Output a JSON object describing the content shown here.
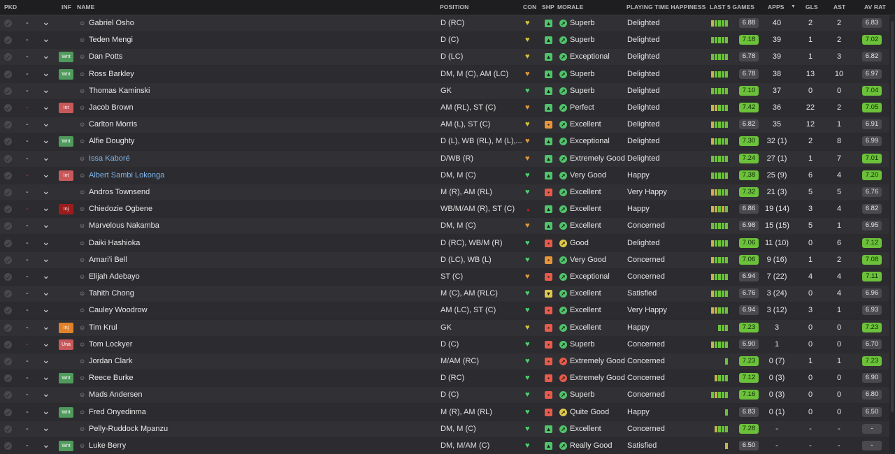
{
  "headers": {
    "pkd": "PKD",
    "inf": "INF",
    "name": "NAME",
    "position": "POSITION",
    "con": "CON",
    "shp": "SHP",
    "morale": "MORALE",
    "pth": "PLAYING TIME HAPPINESS",
    "last5": "LAST 5 GAMES",
    "apps": "APPS",
    "sort_indicator": "▼",
    "gls": "GLS",
    "ast": "AST",
    "avrat": "AV RAT"
  },
  "colors": {
    "rating_green": "#6cc13a",
    "rating_grey": "#4a4a4e",
    "link_blue": "#7fb4e8",
    "warn_red": "#c0392b"
  },
  "players": [
    {
      "pkd": "-",
      "pkd_red": false,
      "inf": "",
      "name": "Gabriel Osho",
      "link": false,
      "position": "D (RC)",
      "con": "yellow",
      "shp": "green",
      "mor_icon": "green",
      "morale": "Superb",
      "pth": "Delighted",
      "last5": [
        "y",
        "g",
        "g",
        "g",
        "g"
      ],
      "l5val": "6.88",
      "l5green": false,
      "apps": "40",
      "gls": "2",
      "ast": "2",
      "avrat": "6.83",
      "avgreen": false
    },
    {
      "pkd": "-",
      "pkd_red": false,
      "inf": "",
      "name": "Teden Mengi",
      "link": false,
      "position": "D (C)",
      "con": "yellow",
      "shp": "green",
      "mor_icon": "green",
      "morale": "Superb",
      "pth": "Delighted",
      "last5": [
        "g",
        "g",
        "g",
        "g",
        "g"
      ],
      "l5val": "7.18",
      "l5green": true,
      "apps": "39",
      "gls": "1",
      "ast": "2",
      "avrat": "7.02",
      "avgreen": true
    },
    {
      "pkd": "-",
      "pkd_red": false,
      "inf": "Wnt",
      "name": "Dan Potts",
      "link": false,
      "position": "D (LC)",
      "con": "yellow",
      "shp": "green",
      "mor_icon": "green",
      "morale": "Exceptional",
      "pth": "Delighted",
      "last5": [
        "g",
        "g",
        "g",
        "g",
        "g"
      ],
      "l5val": "6.78",
      "l5green": false,
      "apps": "39",
      "gls": "1",
      "ast": "3",
      "avrat": "6.82",
      "avgreen": false
    },
    {
      "pkd": "-",
      "pkd_red": false,
      "inf": "Wnt",
      "name": "Ross Barkley",
      "link": false,
      "position": "DM, M (C), AM (LC)",
      "con": "orange",
      "shp": "green",
      "mor_icon": "green",
      "morale": "Superb",
      "pth": "Delighted",
      "last5": [
        "y",
        "g",
        "g",
        "g",
        "g"
      ],
      "l5val": "6.78",
      "l5green": false,
      "apps": "38",
      "gls": "13",
      "ast": "10",
      "avrat": "6.97",
      "avgreen": false
    },
    {
      "pkd": "-",
      "pkd_red": false,
      "inf": "",
      "name": "Thomas Kaminski",
      "link": false,
      "position": "GK",
      "con": "green",
      "shp": "green",
      "mor_icon": "green",
      "morale": "Superb",
      "pth": "Delighted",
      "last5": [
        "g",
        "g",
        "g",
        "g",
        "g"
      ],
      "l5val": "7.10",
      "l5green": true,
      "apps": "37",
      "gls": "0",
      "ast": "0",
      "avrat": "7.04",
      "avgreen": true
    },
    {
      "pkd": "-",
      "pkd_red": true,
      "inf": "Int",
      "name": "Jacob Brown",
      "link": false,
      "position": "AM (RL), ST (C)",
      "con": "orange",
      "shp": "green",
      "mor_icon": "green",
      "morale": "Perfect",
      "pth": "Delighted",
      "last5": [
        "y",
        "y",
        "g",
        "g",
        "g"
      ],
      "l5val": "7.42",
      "l5green": true,
      "apps": "36",
      "gls": "22",
      "ast": "2",
      "avrat": "7.05",
      "avgreen": true
    },
    {
      "pkd": "-",
      "pkd_red": false,
      "inf": "",
      "name": "Carlton Morris",
      "link": false,
      "position": "AM (L), ST (C)",
      "con": "yellow",
      "shp": "orange",
      "mor_icon": "green",
      "morale": "Excellent",
      "pth": "Delighted",
      "last5": [
        "y",
        "g",
        "g",
        "g",
        "g"
      ],
      "l5val": "6.82",
      "l5green": false,
      "apps": "35",
      "gls": "12",
      "ast": "1",
      "avrat": "6.91",
      "avgreen": false
    },
    {
      "pkd": "-",
      "pkd_red": false,
      "inf": "Wnt",
      "name": "Alfie Doughty",
      "link": false,
      "position": "D (L), WB (RL), M (L),...",
      "con": "orange",
      "shp": "green",
      "mor_icon": "green",
      "morale": "Exceptional",
      "pth": "Delighted",
      "last5": [
        "y",
        "g",
        "g",
        "g",
        "g"
      ],
      "l5val": "7.30",
      "l5green": true,
      "apps": "32 (1)",
      "gls": "2",
      "ast": "8",
      "avrat": "6.99",
      "avgreen": false
    },
    {
      "pkd": "-",
      "pkd_red": false,
      "inf": "",
      "name": "Issa Kaboré",
      "link": true,
      "position": "D/WB (R)",
      "con": "orange",
      "shp": "green",
      "mor_icon": "green",
      "morale": "Extremely Good",
      "pth": "Delighted",
      "last5": [
        "g",
        "g",
        "g",
        "g",
        "g"
      ],
      "l5val": "7.24",
      "l5green": true,
      "apps": "27 (1)",
      "gls": "1",
      "ast": "7",
      "avrat": "7.01",
      "avgreen": true
    },
    {
      "pkd": "-",
      "pkd_red": true,
      "inf": "Int",
      "name": "Albert Sambi Lokonga",
      "link": true,
      "position": "DM, M (C)",
      "con": "green",
      "shp": "green",
      "mor_icon": "green",
      "morale": "Very Good",
      "pth": "Happy",
      "last5": [
        "g",
        "g",
        "g",
        "g",
        "g"
      ],
      "l5val": "7.38",
      "l5green": true,
      "apps": "25 (9)",
      "gls": "6",
      "ast": "4",
      "avrat": "7.20",
      "avgreen": true
    },
    {
      "pkd": "-",
      "pkd_red": false,
      "inf": "",
      "name": "Andros Townsend",
      "link": false,
      "position": "M (R), AM (RL)",
      "con": "green",
      "shp": "red",
      "mor_icon": "green",
      "morale": "Excellent",
      "pth": "Very Happy",
      "last5": [
        "y",
        "y",
        "g",
        "g",
        "g"
      ],
      "l5val": "7.32",
      "l5green": true,
      "apps": "21 (3)",
      "gls": "5",
      "ast": "5",
      "avrat": "6.76",
      "avgreen": false
    },
    {
      "pkd": "-",
      "pkd_red": true,
      "inf": "Inj",
      "name": "Chiedozie Ogbene",
      "link": false,
      "position": "WB/M/AM (R), ST (C)",
      "con": "injury",
      "shp": "green",
      "mor_icon": "green",
      "morale": "Excellent",
      "pth": "Happy",
      "last5": [
        "y",
        "y",
        "g",
        "y",
        "g"
      ],
      "l5val": "6.86",
      "l5green": false,
      "apps": "19 (14)",
      "gls": "3",
      "ast": "4",
      "avrat": "6.82",
      "avgreen": false
    },
    {
      "pkd": "-",
      "pkd_red": false,
      "inf": "",
      "name": "Marvelous Nakamba",
      "link": false,
      "position": "DM, M (C)",
      "con": "orange",
      "shp": "green",
      "mor_icon": "green",
      "morale": "Excellent",
      "pth": "Concerned",
      "last5": [
        "g",
        "g",
        "g",
        "g",
        "g"
      ],
      "l5val": "6.98",
      "l5green": false,
      "apps": "15 (15)",
      "gls": "5",
      "ast": "1",
      "avrat": "6.95",
      "avgreen": false
    },
    {
      "pkd": "-",
      "pkd_red": false,
      "inf": "",
      "name": "Daiki Hashioka",
      "link": false,
      "position": "D (RC), WB/M (R)",
      "con": "green",
      "shp": "red",
      "mor_icon": "yellow",
      "morale": "Good",
      "pth": "Delighted",
      "last5": [
        "y",
        "g",
        "g",
        "g",
        "g"
      ],
      "l5val": "7.06",
      "l5green": true,
      "apps": "11 (10)",
      "gls": "0",
      "ast": "6",
      "avrat": "7.12",
      "avgreen": true
    },
    {
      "pkd": "-",
      "pkd_red": false,
      "inf": "",
      "name": "Amari'i Bell",
      "link": false,
      "position": "D (LC), WB (L)",
      "con": "green",
      "shp": "orange",
      "mor_icon": "green",
      "morale": "Very Good",
      "pth": "Concerned",
      "last5": [
        "y",
        "g",
        "g",
        "g",
        "g"
      ],
      "l5val": "7.06",
      "l5green": true,
      "apps": "9 (16)",
      "gls": "1",
      "ast": "2",
      "avrat": "7.08",
      "avgreen": true
    },
    {
      "pkd": "-",
      "pkd_red": false,
      "inf": "",
      "name": "Elijah Adebayo",
      "link": false,
      "position": "ST (C)",
      "con": "orange",
      "shp": "red",
      "mor_icon": "green",
      "morale": "Exceptional",
      "pth": "Concerned",
      "last5": [
        "y",
        "g",
        "g",
        "g",
        "g"
      ],
      "l5val": "6.94",
      "l5green": false,
      "apps": "7 (22)",
      "gls": "4",
      "ast": "4",
      "avrat": "7.11",
      "avgreen": true
    },
    {
      "pkd": "-",
      "pkd_red": false,
      "inf": "",
      "name": "Tahith Chong",
      "link": false,
      "position": "M (C), AM (RLC)",
      "con": "green",
      "shp": "yellow",
      "mor_icon": "green",
      "morale": "Excellent",
      "pth": "Satisfied",
      "last5": [
        "y",
        "g",
        "g",
        "g",
        "g"
      ],
      "l5val": "6.76",
      "l5green": false,
      "apps": "3 (24)",
      "gls": "0",
      "ast": "4",
      "avrat": "6.96",
      "avgreen": false
    },
    {
      "pkd": "-",
      "pkd_red": false,
      "inf": "",
      "name": "Cauley Woodrow",
      "link": false,
      "position": "AM (LC), ST (C)",
      "con": "green",
      "shp": "red",
      "mor_icon": "green",
      "morale": "Excellent",
      "pth": "Very Happy",
      "last5": [
        "y",
        "y",
        "g",
        "g",
        "g"
      ],
      "l5val": "6.94",
      "l5green": false,
      "apps": "3 (12)",
      "gls": "3",
      "ast": "1",
      "avrat": "6.93",
      "avgreen": false
    },
    {
      "pkd": "-",
      "pkd_red": false,
      "inf": "Inj2",
      "name": "Tim Krul",
      "link": false,
      "position": "GK",
      "con": "yellow",
      "shp": "red",
      "mor_icon": "green",
      "morale": "Excellent",
      "pth": "Happy",
      "last5": [
        "",
        "",
        "g",
        "g",
        "g"
      ],
      "l5val": "7.23",
      "l5green": true,
      "apps": "3",
      "gls": "0",
      "ast": "0",
      "avrat": "7.23",
      "avgreen": true
    },
    {
      "pkd": "-",
      "pkd_red": true,
      "inf": "Una",
      "name": "Tom Lockyer",
      "link": false,
      "position": "D (C)",
      "con": "green",
      "shp": "red",
      "mor_icon": "green",
      "morale": "Superb",
      "pth": "Concerned",
      "last5": [
        "y",
        "g",
        "g",
        "g",
        "g"
      ],
      "l5val": "6.90",
      "l5green": false,
      "apps": "1",
      "gls": "0",
      "ast": "0",
      "avrat": "6.70",
      "avgreen": false
    },
    {
      "pkd": "-",
      "pkd_red": false,
      "inf": "",
      "name": "Jordan Clark",
      "link": false,
      "position": "M/AM (RC)",
      "con": "green",
      "shp": "red",
      "mor_icon": "red",
      "morale": "Extremely Good",
      "pth": "Concerned",
      "last5": [
        "",
        "",
        "",
        "",
        "g"
      ],
      "l5val": "7.23",
      "l5green": true,
      "apps": "0 (7)",
      "gls": "1",
      "ast": "1",
      "avrat": "7.23",
      "avgreen": true
    },
    {
      "pkd": "-",
      "pkd_red": false,
      "inf": "Wnt",
      "name": "Reece Burke",
      "link": false,
      "position": "D (RC)",
      "con": "green",
      "shp": "red",
      "mor_icon": "red",
      "morale": "Extremely Good",
      "pth": "Concerned",
      "last5": [
        "",
        "y",
        "g",
        "g",
        "g"
      ],
      "l5val": "7.12",
      "l5green": true,
      "apps": "0 (3)",
      "gls": "0",
      "ast": "0",
      "avrat": "6.90",
      "avgreen": false
    },
    {
      "pkd": "-",
      "pkd_red": false,
      "inf": "",
      "name": "Mads Andersen",
      "link": false,
      "position": "D (C)",
      "con": "green",
      "shp": "red",
      "mor_icon": "green",
      "morale": "Superb",
      "pth": "Concerned",
      "last5": [
        "g",
        "y",
        "g",
        "g",
        "g"
      ],
      "l5val": "7.16",
      "l5green": true,
      "apps": "0 (3)",
      "gls": "0",
      "ast": "0",
      "avrat": "6.80",
      "avgreen": false
    },
    {
      "pkd": "-",
      "pkd_red": false,
      "inf": "Wnt",
      "name": "Fred Onyedinma",
      "link": false,
      "position": "M (R), AM (RL)",
      "con": "green",
      "shp": "red",
      "mor_icon": "yellow",
      "morale": "Quite Good",
      "pth": "Happy",
      "last5": [
        "",
        "",
        "",
        "",
        "g"
      ],
      "l5val": "6.83",
      "l5green": false,
      "apps": "0 (1)",
      "gls": "0",
      "ast": "0",
      "avrat": "6.50",
      "avgreen": false
    },
    {
      "pkd": "-",
      "pkd_red": false,
      "inf": "",
      "name": "Pelly-Ruddock Mpanzu",
      "link": false,
      "position": "DM, M (C)",
      "con": "green",
      "shp": "green",
      "mor_icon": "green",
      "morale": "Excellent",
      "pth": "Concerned",
      "last5": [
        "",
        "y",
        "g",
        "g",
        "g"
      ],
      "l5val": "7.28",
      "l5green": true,
      "apps": "-",
      "gls": "-",
      "ast": "-",
      "avrat": "-",
      "avgreen": false
    },
    {
      "pkd": "-",
      "pkd_red": false,
      "inf": "Wnt",
      "name": "Luke Berry",
      "link": false,
      "position": "DM, M/AM (C)",
      "con": "green",
      "shp": "green",
      "mor_icon": "green",
      "morale": "Really Good",
      "pth": "Satisfied",
      "last5": [
        "",
        "",
        "",
        "",
        "y"
      ],
      "l5val": "6.50",
      "l5green": false,
      "apps": "-",
      "gls": "-",
      "ast": "-",
      "avrat": "-",
      "avgreen": false
    }
  ]
}
